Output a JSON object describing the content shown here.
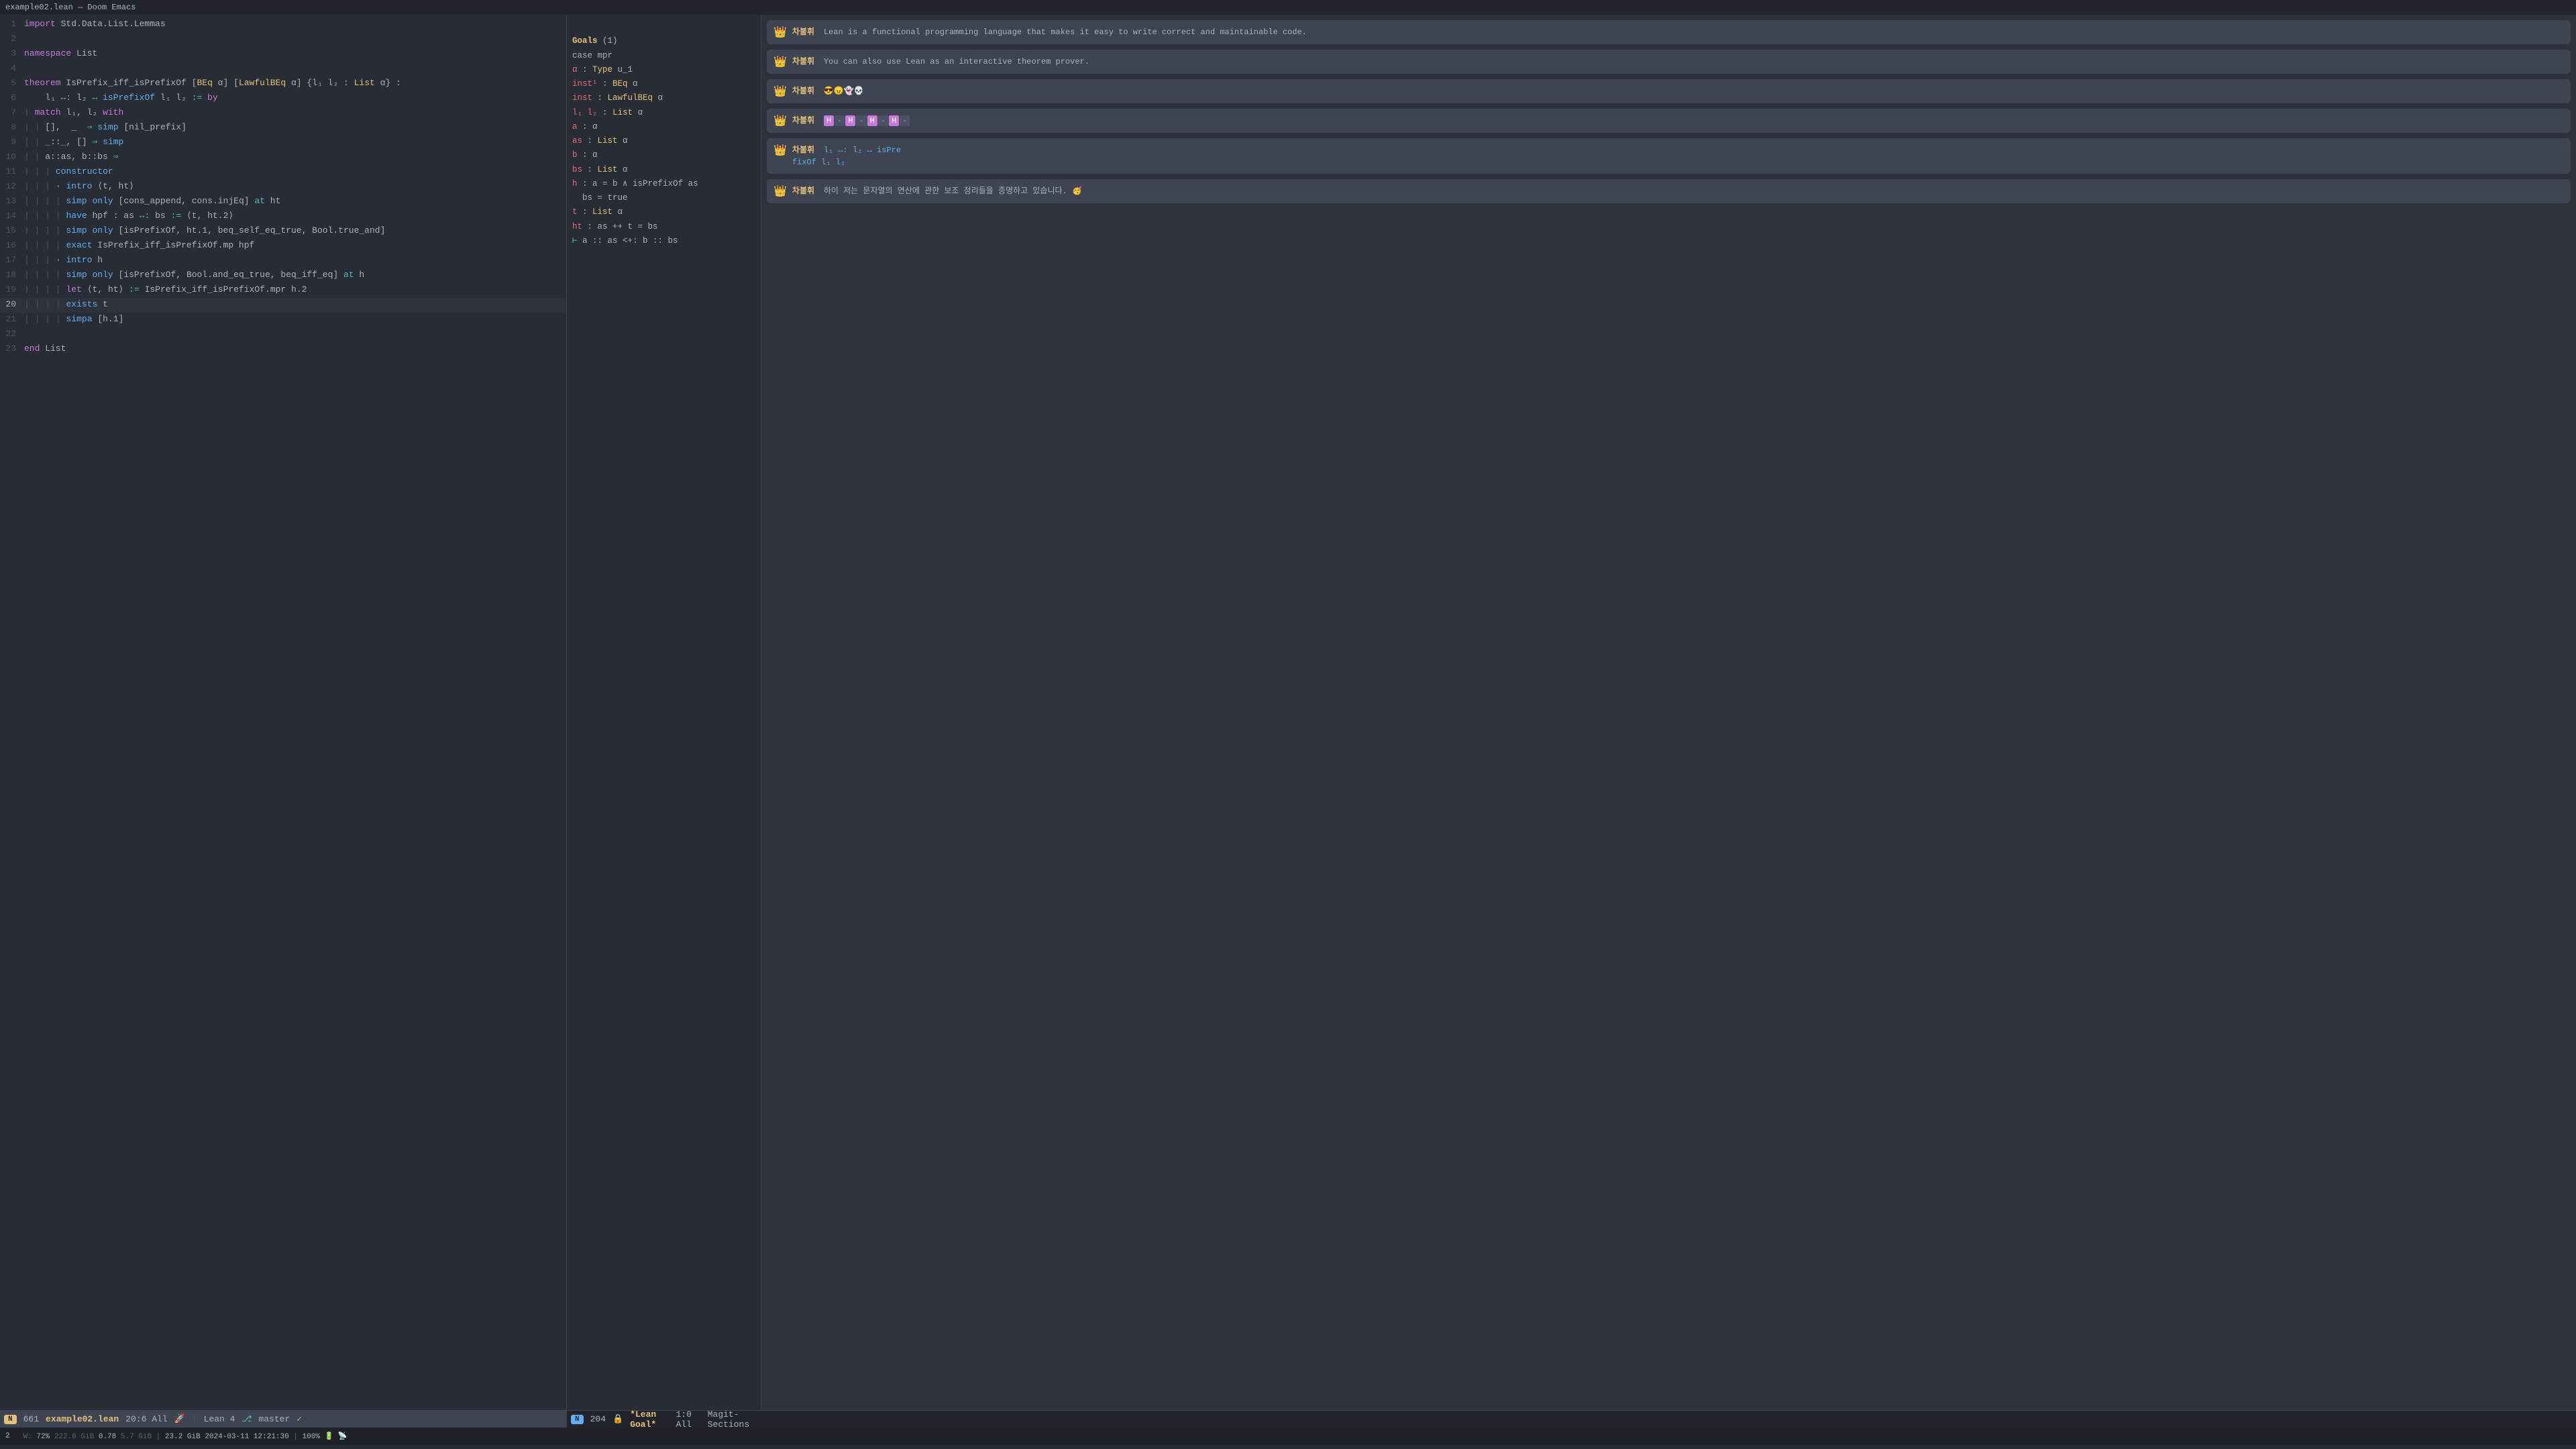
{
  "titleBar": {
    "text": "example02.lean — Doom Emacs"
  },
  "editor": {
    "lines": [
      {
        "num": 1,
        "content": "import Std.Data.List.Lemmas",
        "tokens": [
          {
            "t": "kw",
            "v": "import"
          },
          {
            "t": "ident",
            "v": " Std.Data.List.Lemmas"
          }
        ]
      },
      {
        "num": 2,
        "content": "",
        "tokens": []
      },
      {
        "num": 3,
        "content": "namespace List",
        "tokens": [
          {
            "t": "kw",
            "v": "namespace"
          },
          {
            "t": "ident",
            "v": " List"
          }
        ]
      },
      {
        "num": 4,
        "content": "",
        "tokens": []
      },
      {
        "num": 5,
        "content": "theorem IsPrefix_iff_isPrefixOf [BEq α] [LawfulBEq α] {l₁ l₂ : List α} :",
        "tokens": []
      },
      {
        "num": 6,
        "content": "  l₁ ↔: l₂ ↔ isPrefixOf l₁ l₂ := by",
        "tokens": []
      },
      {
        "num": 7,
        "content": "| match l₁, l₂ with",
        "tokens": []
      },
      {
        "num": 8,
        "content": "| | [],  _  ⇒ simp [nil_prefix]",
        "tokens": []
      },
      {
        "num": 9,
        "content": "| | _::_, [] ⇒ simp",
        "tokens": []
      },
      {
        "num": 10,
        "content": "| | a::as, b::bs ⇒",
        "tokens": []
      },
      {
        "num": 11,
        "content": "| | | constructor",
        "tokens": []
      },
      {
        "num": 12,
        "content": "| | | · intro ⟨t, ht⟩",
        "tokens": []
      },
      {
        "num": 13,
        "content": "| | | | simp only [cons_append, cons.injEq] at ht",
        "tokens": []
      },
      {
        "num": 14,
        "content": "| | | | have hpf : as ↔: bs := ⟨t, ht.2⟩",
        "tokens": []
      },
      {
        "num": 15,
        "content": "| | | | simp only [isPrefixOf, ht.1, beq_self_eq_true, Bool.true_and]",
        "tokens": []
      },
      {
        "num": 16,
        "content": "| | | | exact IsPrefix_iff_isPrefixOf.mp hpf",
        "tokens": []
      },
      {
        "num": 17,
        "content": "| | | · intro h",
        "tokens": []
      },
      {
        "num": 18,
        "content": "| | | | simp only [isPrefixOf, Bool.and_eq_true, beq_iff_eq] at h",
        "tokens": []
      },
      {
        "num": 19,
        "content": "| | | | let ⟨t, ht⟩ := IsPrefix_iff_isPrefixOf.mpr h.2",
        "tokens": []
      },
      {
        "num": 20,
        "content": "| | | | exists t",
        "tokens": [],
        "highlight": true
      },
      {
        "num": 21,
        "content": "| | | | simpa [h.1]",
        "tokens": []
      },
      {
        "num": 22,
        "content": "",
        "tokens": []
      },
      {
        "num": 23,
        "content": "end List",
        "tokens": [
          {
            "t": "kw",
            "v": "end"
          },
          {
            "t": "ident",
            "v": " List"
          }
        ]
      }
    ]
  },
  "goals": {
    "title": "Goals",
    "count": "(1)",
    "case": "case mpr",
    "context": [
      "α : Type u_1",
      "inst¹ : BEq α",
      "inst : LawfulBEq α",
      "l₁ l₂ : List α",
      "a : α",
      "as : List α",
      "b : α",
      "bs : List α",
      "h : a = b ∧ isPrefixOf as bs = true",
      "t : List α",
      "ht : as ++ t = bs",
      "⊢ a :: as <+: b :: bs"
    ]
  },
  "chat": {
    "messages": [
      {
        "id": 1,
        "avatar": "👑",
        "username": "차불휘",
        "text": "Lean is a functional programming language that makes it easy to write correct and maintainable code."
      },
      {
        "id": 2,
        "avatar": "👑",
        "username": "차불휘",
        "text": "You can also use Lean as an interactive theorem prover."
      },
      {
        "id": 3,
        "avatar": "👑",
        "username": "차불휘",
        "text": "😎😠👻💀"
      },
      {
        "id": 4,
        "avatar": "👑",
        "username": "차불휘",
        "text": "🟪🟪🟪🟪🟪🟪"
      },
      {
        "id": 5,
        "avatar": "👑",
        "username": "차불휘",
        "text": "l₁ ↔: l₂ ↔ isPrefix Of l₁ l₂"
      },
      {
        "id": 6,
        "avatar": "👑",
        "username": "차불휘",
        "text": "하이  저는 문자열의 연산에 관한 보조 정리들을 증명하고 있습니다. 🥳"
      }
    ]
  },
  "modelineEditor": {
    "indicator": "N",
    "lineCount": "661",
    "filename": "example02.lean",
    "position": "20:6 All",
    "rocket": "🚀",
    "leanVersion": "Lean 4",
    "branch": "master"
  },
  "modelineGoals": {
    "indicator": "N",
    "lineCount": "204",
    "lock": "🔒",
    "filename": "*Lean Goal*",
    "position": "1:0 All",
    "sections": "Magit-Sections"
  },
  "bottomBar": {
    "num": "2",
    "stats": "W: 72% 222.6 GiB 0.78 5.7 GiB | 23.2 GiB 2024-03-11 12:21:30 | 100% 🔋 📡"
  }
}
